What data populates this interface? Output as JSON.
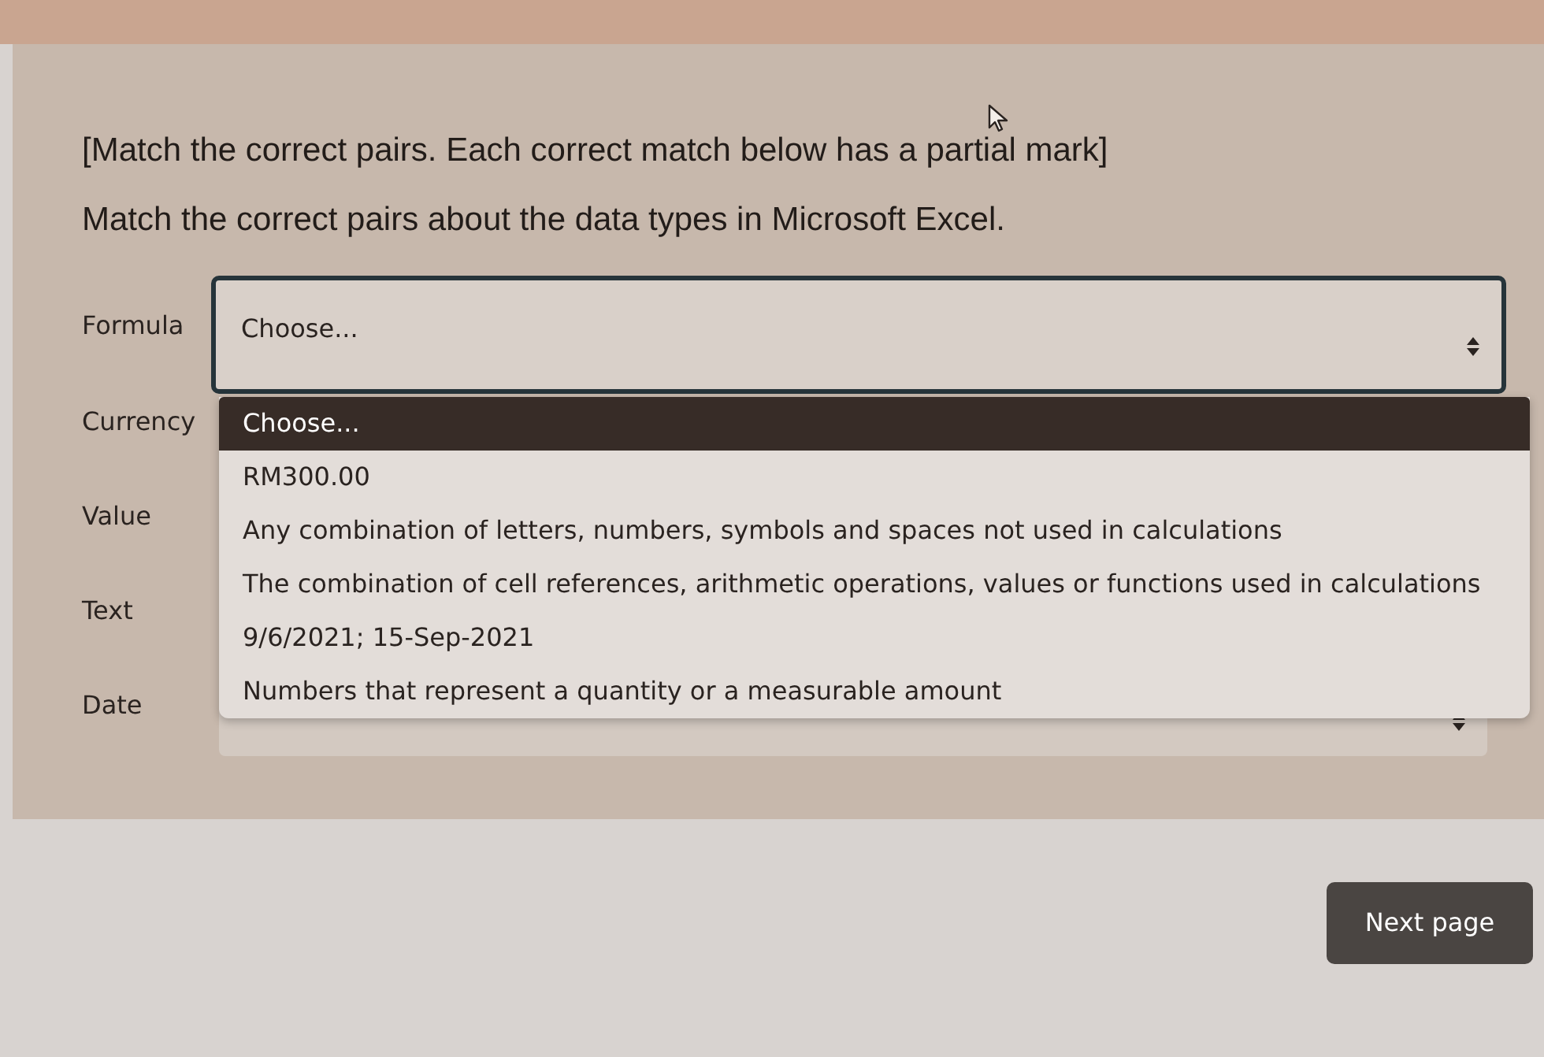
{
  "instructions": [
    "[Match the correct pairs. Each correct match below has a partial mark]",
    "Match the correct pairs about the data types in Microsoft Excel."
  ],
  "pairs": [
    {
      "label": "Formula",
      "value": "Choose...",
      "focused": true
    },
    {
      "label": "Currency"
    },
    {
      "label": "Value"
    },
    {
      "label": "Text"
    },
    {
      "label": "Date"
    }
  ],
  "dropdown_options": [
    {
      "label": "Choose...",
      "selected": true
    },
    {
      "label": "RM300.00",
      "selected": false
    },
    {
      "label": "Any combination of letters, numbers, symbols and spaces not used in calculations",
      "selected": false
    },
    {
      "label": "The combination of cell references, arithmetic operations, values or functions used in calculations",
      "selected": false
    },
    {
      "label": "9/6/2021; 15-Sep-2021",
      "selected": false
    },
    {
      "label": "Numbers that represent a quantity or a measurable amount",
      "selected": false
    }
  ],
  "next_button": "Next page"
}
